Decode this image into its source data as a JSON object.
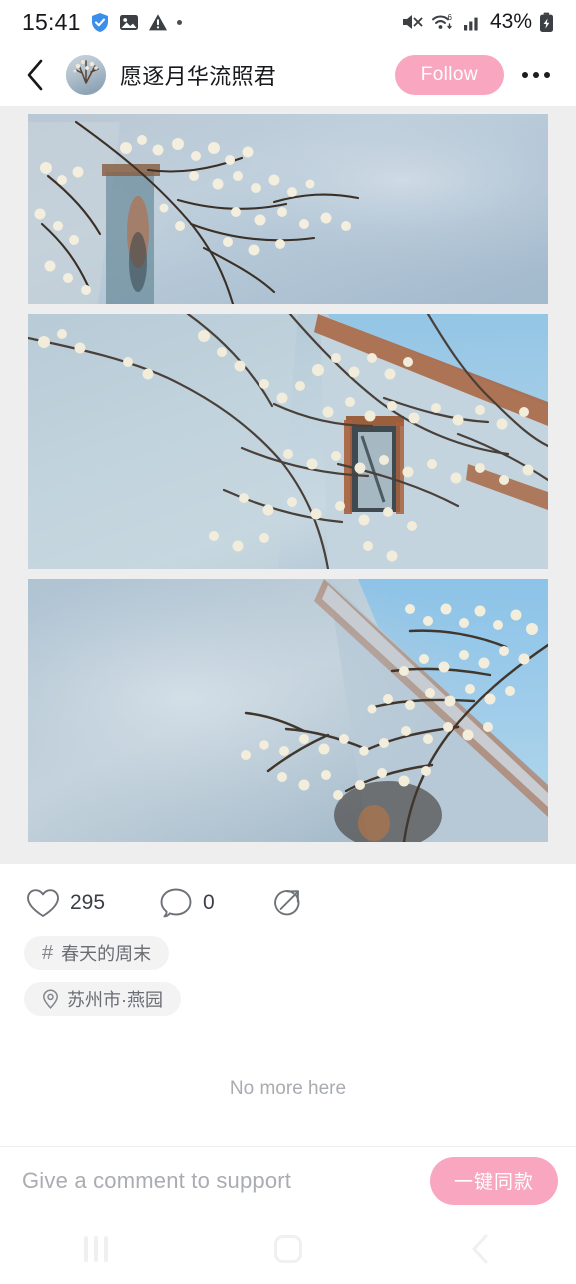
{
  "status_bar": {
    "time": "15:41",
    "left_icons": [
      "shield-check-icon",
      "image-icon",
      "warning-triangle-icon",
      "dot-icon"
    ],
    "right_icons": [
      "mute-icon",
      "wifi-icon",
      "signal-icon",
      "battery-icon"
    ],
    "battery_text": "43%",
    "wifi_label": "6"
  },
  "header": {
    "back_icon": "chevron-left-icon",
    "avatar_alt": "user-avatar",
    "username": "愿逐月华流照君",
    "follow_label": "Follow",
    "follow_color": "#f9a6c0",
    "more_icon": "more-horizontal-icon"
  },
  "post": {
    "photos": [
      {
        "alt": "plum blossom branch over blue wall with window",
        "icon": "photo-icon"
      },
      {
        "alt": "blossoms against weathered wall with window and sky",
        "icon": "photo-icon"
      },
      {
        "alt": "blossom branch with blurred wall and rooftop",
        "icon": "photo-icon"
      }
    ],
    "actions": {
      "like_icon": "heart-icon",
      "like_count": "295",
      "comment_icon": "comment-bubble-icon",
      "comment_count": "0",
      "share_icon": "share-arrow-icon"
    },
    "tags": [
      {
        "icon": "hash-icon",
        "symbol": "#",
        "label": "春天的周末"
      },
      {
        "icon": "location-pin-icon",
        "symbol": "",
        "label": "苏州市·燕园"
      }
    ],
    "end_of_list": "No more here"
  },
  "comment_bar": {
    "placeholder": "Give a comment to support",
    "sync_label": "一键同款",
    "sync_color": "#f9a6c0"
  },
  "nav_bar": {
    "recents_icon": "recents-icon",
    "home_icon": "home-icon",
    "back_icon": "back-chevron-icon"
  }
}
